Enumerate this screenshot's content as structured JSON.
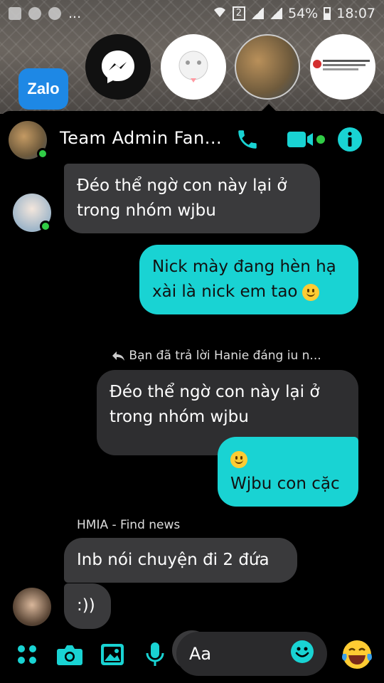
{
  "status_bar": {
    "sim_slot": "2",
    "battery": "54%",
    "time": "18:07",
    "dots": "..."
  },
  "home": {
    "zalo_label": "Zalo"
  },
  "chat": {
    "title": "Team Admin Fan...",
    "accent": "#19d3d3",
    "messages": [
      {
        "side": "in",
        "text": "Đéo thể ngờ con này lại ở\ntrong nhóm wjbu"
      },
      {
        "side": "out",
        "text": "Nick mày đang hèn hạ\nxài là nick em tao",
        "reaction_count": "1"
      },
      {
        "side": "out",
        "reply_label": "Bạn đã trả lời Hanie đáng iu n...",
        "quoted_text": "Đéo thể ngờ con này lại ở\ntrong nhóm wjbu",
        "text": "Wjbu con cặc"
      },
      {
        "side": "in",
        "sender": "HMIA - Find news",
        "text": "Inb nói chuyện đi 2 đứa"
      },
      {
        "side": "in",
        "text": ":))"
      }
    ]
  },
  "composer": {
    "placeholder": "Aa"
  }
}
